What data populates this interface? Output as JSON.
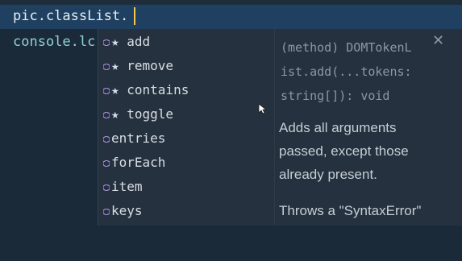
{
  "editor": {
    "line1": "pic.classList.",
    "line2": "console.lc"
  },
  "suggestions": [
    {
      "label": "★ add",
      "kind": "method-icon"
    },
    {
      "label": "★ remove",
      "kind": "method-icon"
    },
    {
      "label": "★ contains",
      "kind": "method-icon"
    },
    {
      "label": "★ toggle",
      "kind": "method-icon"
    },
    {
      "label": "entries",
      "kind": "method-icon"
    },
    {
      "label": "forEach",
      "kind": "method-icon"
    },
    {
      "label": "item",
      "kind": "method-icon"
    },
    {
      "label": "keys",
      "kind": "method-icon"
    }
  ],
  "detail": {
    "signature": "(method) DOMTokenL\nist.add(...tokens:\nstring[]): void",
    "description": "Adds all arguments\npassed, except those\nalready present.",
    "description2": "Throws a \"SyntaxError\""
  },
  "colors": {
    "background": "#1b2a38",
    "current_line": "#1f4060",
    "suggest_bg": "#25313e",
    "caret": "#f3c94b",
    "method_icon": "#b48ee6"
  }
}
